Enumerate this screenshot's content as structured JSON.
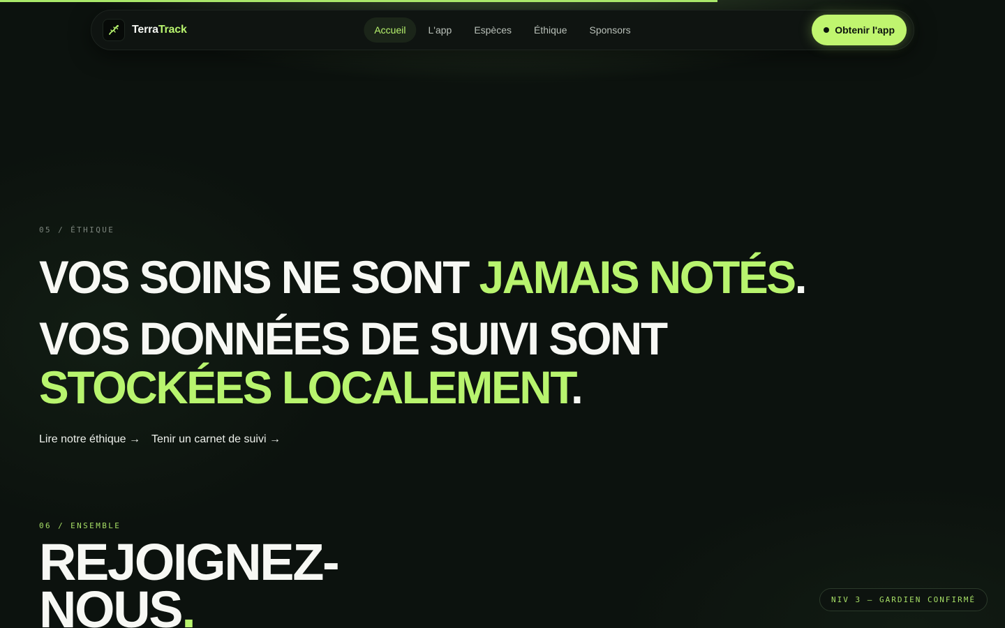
{
  "progress": {
    "fraction": 0.714
  },
  "header": {
    "brand_part1": "Terra",
    "brand_part2": "Track",
    "logo_icon": "lizard-icon",
    "nav": [
      {
        "label": "Accueil",
        "active": true
      },
      {
        "label": "L'app",
        "active": false
      },
      {
        "label": "Espèces",
        "active": false
      },
      {
        "label": "Éthique",
        "active": false
      },
      {
        "label": "Sponsors",
        "active": false
      }
    ],
    "cta_label": "Obtenir l'app"
  },
  "ethics": {
    "eyebrow": "05 / ÉTHIQUE",
    "line1_white": "VOS SOINS NE SONT ",
    "line1_green": "JAMAIS NOTÉS",
    "line2_white": "VOS DONNÉES DE SUIVI SONT",
    "line3_green": "STOCKÉES LOCALEMENT",
    "period": ".",
    "link1": "Lire notre éthique →",
    "link2": "Tenir un carnet de suivi →"
  },
  "together": {
    "eyebrow": "06 / ENSEMBLE",
    "title_line1": "REJOIGNEZ-",
    "title_line2": "NOUS",
    "period": "."
  },
  "badge": {
    "label": "NIV 3 — GARDIEN CONFIRMÉ"
  },
  "colors": {
    "accent": "#b8f46e",
    "background": "#0c120e",
    "text": "#f7f8f4"
  }
}
